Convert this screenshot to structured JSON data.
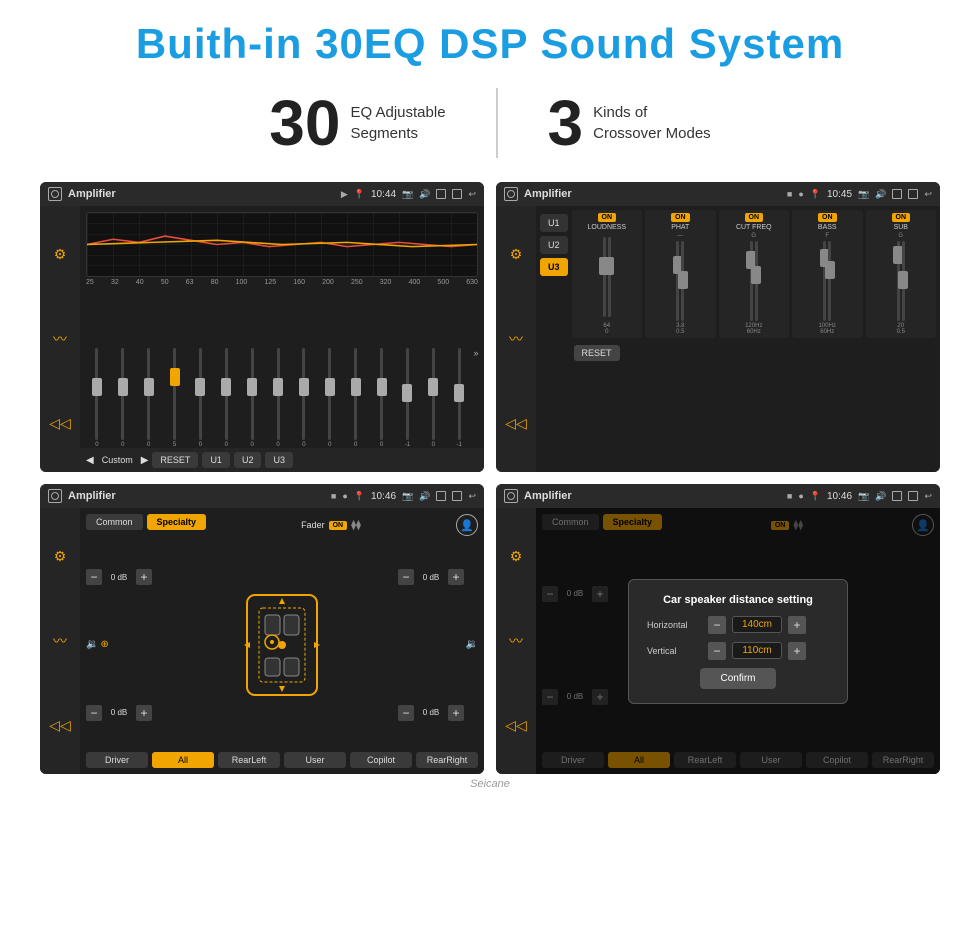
{
  "page": {
    "title": "Buith-in 30EQ DSP Sound System",
    "stats": [
      {
        "number": "30",
        "label": "EQ Adjustable\nSegments"
      },
      {
        "number": "3",
        "label": "Kinds of\nCrossover Modes"
      }
    ]
  },
  "screens": {
    "eq": {
      "title": "Amplifier",
      "time": "10:44",
      "freq_labels": [
        "25",
        "32",
        "40",
        "50",
        "63",
        "80",
        "100",
        "125",
        "160",
        "200",
        "250",
        "320",
        "400",
        "500",
        "630"
      ],
      "slider_values": [
        "0",
        "0",
        "0",
        "5",
        "0",
        "0",
        "0",
        "0",
        "0",
        "0",
        "0",
        "0",
        "-1",
        "0",
        "-1"
      ],
      "bottom_buttons": [
        "RESET",
        "U1",
        "U2",
        "U3"
      ],
      "current_preset": "Custom"
    },
    "crossover": {
      "title": "Amplifier",
      "time": "10:45",
      "tabs": [
        "U1",
        "U2",
        "U3"
      ],
      "active_tab": "U3",
      "channels": [
        {
          "name": "LOUDNESS",
          "on": true
        },
        {
          "name": "PHAT",
          "on": true
        },
        {
          "name": "CUT FREQ",
          "on": true
        },
        {
          "name": "BASS",
          "on": true
        },
        {
          "name": "SUB",
          "on": true
        }
      ],
      "reset_label": "RESET"
    },
    "balance": {
      "title": "Amplifier",
      "time": "10:46",
      "tabs": [
        "Common",
        "Specialty"
      ],
      "active_tab": "Specialty",
      "fader_label": "Fader",
      "fader_on": true,
      "controls": [
        {
          "value": "0 dB"
        },
        {
          "value": "0 dB"
        }
      ],
      "right_controls": [
        {
          "value": "0 dB"
        },
        {
          "value": "0 dB"
        }
      ],
      "bottom_buttons": [
        "Driver",
        "RearLeft",
        "All",
        "User",
        "Copilot",
        "RearRight"
      ],
      "active_bottom": "All"
    },
    "distance": {
      "title": "Amplifier",
      "time": "10:46",
      "tabs": [
        "Common",
        "Specialty"
      ],
      "modal": {
        "title": "Car speaker distance setting",
        "horizontal_label": "Horizontal",
        "horizontal_value": "140cm",
        "vertical_label": "Vertical",
        "vertical_value": "110cm",
        "confirm_label": "Confirm"
      },
      "bottom_buttons": [
        "Driver",
        "RearLeft",
        "All",
        "User",
        "Copilot",
        "RearRight"
      ]
    }
  },
  "watermark": "Seicane"
}
